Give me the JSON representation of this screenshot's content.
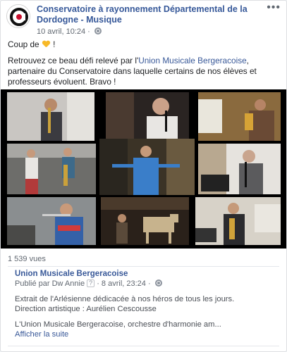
{
  "post": {
    "page_name": "Conservatoire à rayonnement Départemental de la Dordogne - Musique",
    "timestamp": "10 avril, 10:24",
    "separator": " · ",
    "privacy_icon": "globe-icon",
    "more_icon": "more-options-icon",
    "more_label": "•••",
    "line1_prefix": "Coup de",
    "line1_suffix": " !",
    "text_before_link": "Retrouvez ce beau défi relevé par l'",
    "link_text": "Union Musicale Bergeracoise",
    "text_after_link": ", partenaire du Conservatoire dans laquelle certains de nos élèves et professeurs évoluent. Bravo !"
  },
  "video": {
    "views": "1 539 vues"
  },
  "shared": {
    "page_name": "Union Musicale Bergeracoise",
    "published_by": "Publié par Dw Annie",
    "help_mark": "?",
    "time": "· 8 avril, 23:24 ·",
    "line1": "Extrait de l'Arlésienne dédicacée à nos héros de tous les jours.",
    "line2": "Direction artistique : Aurélien Cescousse",
    "line3": "L'Union Musicale Bergeracoise, orchestre d'harmonie am...",
    "see_more": "Afficher la suite"
  },
  "colors": {
    "link": "#385898",
    "heart": "#f7b928",
    "meta": "#606770"
  }
}
